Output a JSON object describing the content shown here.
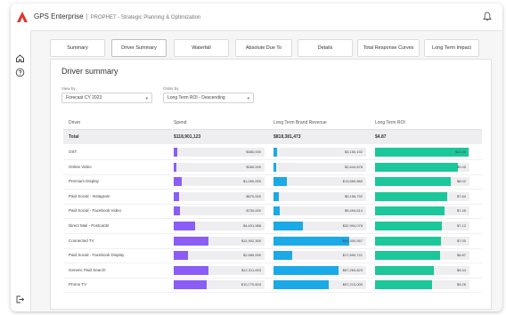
{
  "app": {
    "brand": "GPS Enterprise",
    "separator": "|",
    "subtitle": "PROPHET - Strategic Planning & Optimization"
  },
  "icons": {
    "logo": "app-logo-icon",
    "bell": "bell-icon",
    "home": "home-icon",
    "help": "help-icon",
    "logout": "logout-icon"
  },
  "colors": {
    "brand": "#e0322b",
    "spend_bar": "#8b5cf6",
    "revenue_bar": "#1ba9e8",
    "roi_bar": "#1cc79a"
  },
  "tabs": [
    {
      "label": "Summary"
    },
    {
      "label": "Driver Summary"
    },
    {
      "label": "Waterfall"
    },
    {
      "label": "Absolute Due To"
    },
    {
      "label": "Details"
    },
    {
      "label": "Total Response Curves"
    },
    {
      "label": "Long Term Impact"
    }
  ],
  "page": {
    "title": "Driver summary"
  },
  "filters": {
    "view_by": {
      "label": "View by",
      "value": "Forecast CY 2023"
    },
    "order_by": {
      "label": "Order by",
      "value": "Long Term ROI - Descending"
    }
  },
  "table": {
    "columns": [
      "Driver",
      "Spend",
      "Long Term Brand Revenue",
      "Long Term ROI"
    ],
    "total": {
      "name": "Total",
      "spend": "$118,901,123",
      "revenue": "$818,381,473",
      "roi": "$4.87"
    },
    "rows": [
      {
        "name": "OST",
        "spend": "$380,000",
        "spend_pct": 0.04,
        "revenue": "$3,150,192",
        "revenue_pct": 0.04,
        "roi": "$11.00",
        "roi_pct": 0.99
      },
      {
        "name": "Online Video",
        "spend": "$280,000",
        "spend_pct": 0.03,
        "revenue": "$2,644,878",
        "revenue_pct": 0.03,
        "roi": "$9.45",
        "roi_pct": 0.88
      },
      {
        "name": "Premium Display",
        "spend": "$1,090,000",
        "spend_pct": 0.09,
        "revenue": "$13,560,880",
        "revenue_pct": 0.14,
        "roi": "$8.02",
        "roi_pct": 0.8
      },
      {
        "name": "Paid Social - Instagram",
        "spend": "$670,000",
        "spend_pct": 0.06,
        "revenue": "$5,156,792",
        "revenue_pct": 0.06,
        "roi": "$7.64",
        "roi_pct": 0.76
      },
      {
        "name": "Paid Social - Facebook Video",
        "spend": "$730,000",
        "spend_pct": 0.065,
        "revenue": "$5,494,614",
        "revenue_pct": 0.065,
        "roi": "$7.45",
        "roi_pct": 0.74
      },
      {
        "name": "Direct Mail - Postcards",
        "spend": "$4,631,988",
        "spend_pct": 0.24,
        "revenue": "$32,994,078",
        "revenue_pct": 0.32,
        "roi": "$7.12",
        "roi_pct": 0.71
      },
      {
        "name": "Connected TV",
        "spend": "$11,902,300",
        "spend_pct": 0.38,
        "revenue": "$89,300,557",
        "revenue_pct": 0.82,
        "roi": "$7.00",
        "roi_pct": 0.7
      },
      {
        "name": "Paid Social - Facebook Display",
        "spend": "$2,689,000",
        "spend_pct": 0.16,
        "revenue": "$17,890,721",
        "revenue_pct": 0.2,
        "roi": "$6.87",
        "roi_pct": 0.69
      },
      {
        "name": "Generic Paid Search",
        "spend": "$12,311,693",
        "spend_pct": 0.38,
        "revenue": "$67,263,823",
        "revenue_pct": 0.7,
        "roi": "$5.44",
        "roi_pct": 0.62
      },
      {
        "name": "Promo TV",
        "spend": "$10,770,603",
        "spend_pct": 0.36,
        "revenue": "$57,213,000",
        "revenue_pct": 0.6,
        "roi": "$5.26",
        "roi_pct": 0.6
      }
    ]
  }
}
